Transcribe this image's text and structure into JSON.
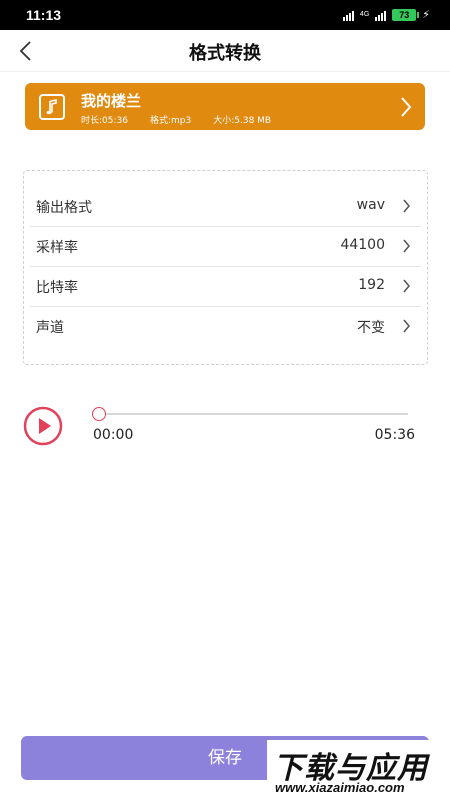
{
  "status_bar": {
    "time": "11:13",
    "network": "4G",
    "battery": "73"
  },
  "header": {
    "title": "格式转换"
  },
  "file": {
    "name": "我的楼兰",
    "duration": "时长:05:36",
    "format": "格式:mp3",
    "size": "大小:5.38 MB"
  },
  "settings": [
    {
      "label": "输出格式",
      "value": "wav"
    },
    {
      "label": "采样率",
      "value": "44100"
    },
    {
      "label": "比特率",
      "value": "192"
    },
    {
      "label": "声道",
      "value": "不变"
    }
  ],
  "player": {
    "current_time": "00:00",
    "total_time": "05:36",
    "progress": 0
  },
  "actions": {
    "save_label": "保存"
  },
  "watermark": {
    "title": "下载与应用",
    "url": "www.xiazaimiao.com"
  },
  "colors": {
    "card": "#e08a10",
    "accent": "#e3405a",
    "save_button": "#8c82dc"
  }
}
